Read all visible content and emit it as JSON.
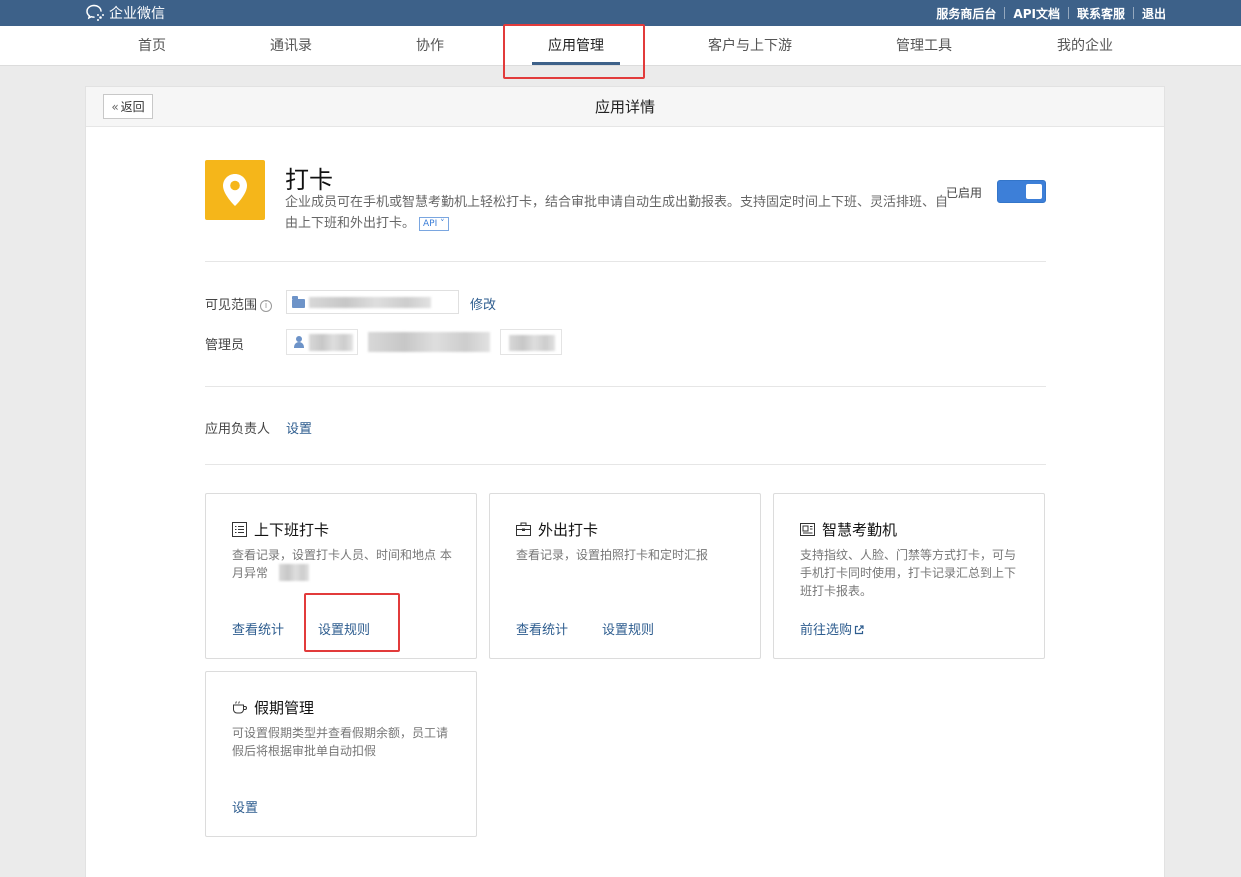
{
  "topbar": {
    "brand": "企业微信",
    "links": [
      "服务商后台",
      "API文档",
      "联系客服",
      "退出"
    ]
  },
  "nav": {
    "items": [
      "首页",
      "通讯录",
      "协作",
      "应用管理",
      "客户与上下游",
      "管理工具",
      "我的企业"
    ],
    "active": "应用管理"
  },
  "panel": {
    "back_label": "返回",
    "title": "应用详情"
  },
  "app": {
    "name": "打卡",
    "description": "企业成员可在手机或智慧考勤机上轻松打卡，结合审批申请自动生成出勤报表。支持固定时间上下班、灵活排班、自由上下班和外出打卡。",
    "api_tag": "API",
    "status_label": "已启用",
    "enabled": true
  },
  "fields": {
    "scope_label": "可见范围",
    "scope_edit": "修改",
    "admin_label": "管理员",
    "owner_label": "应用负责人",
    "owner_action": "设置"
  },
  "cards": [
    {
      "title": "上下班打卡",
      "icon": "list-icon",
      "description": "查看记录，设置打卡人员、时间和地点 本月异常",
      "links": [
        "查看统计",
        "设置规则"
      ]
    },
    {
      "title": "外出打卡",
      "icon": "briefcase-icon",
      "description": "查看记录，设置拍照打卡和定时汇报",
      "links": [
        "查看统计",
        "设置规则"
      ]
    },
    {
      "title": "智慧考勤机",
      "icon": "attendance-machine-icon",
      "description": "支持指纹、人脸、门禁等方式打卡，可与手机打卡同时使用，打卡记录汇总到上下班打卡报表。",
      "links": [
        "前往选购"
      ]
    },
    {
      "title": "假期管理",
      "icon": "cup-icon",
      "description": "可设置假期类型并查看假期余额，员工请假后将根据审批单自动扣假",
      "links": [
        "设置"
      ]
    }
  ],
  "colors": {
    "topbar": "#3d6189",
    "link": "#2e5d8f",
    "app_icon": "#f5b61a",
    "toggle_on": "#3d7fd8",
    "highlight": "#e23b3b"
  }
}
